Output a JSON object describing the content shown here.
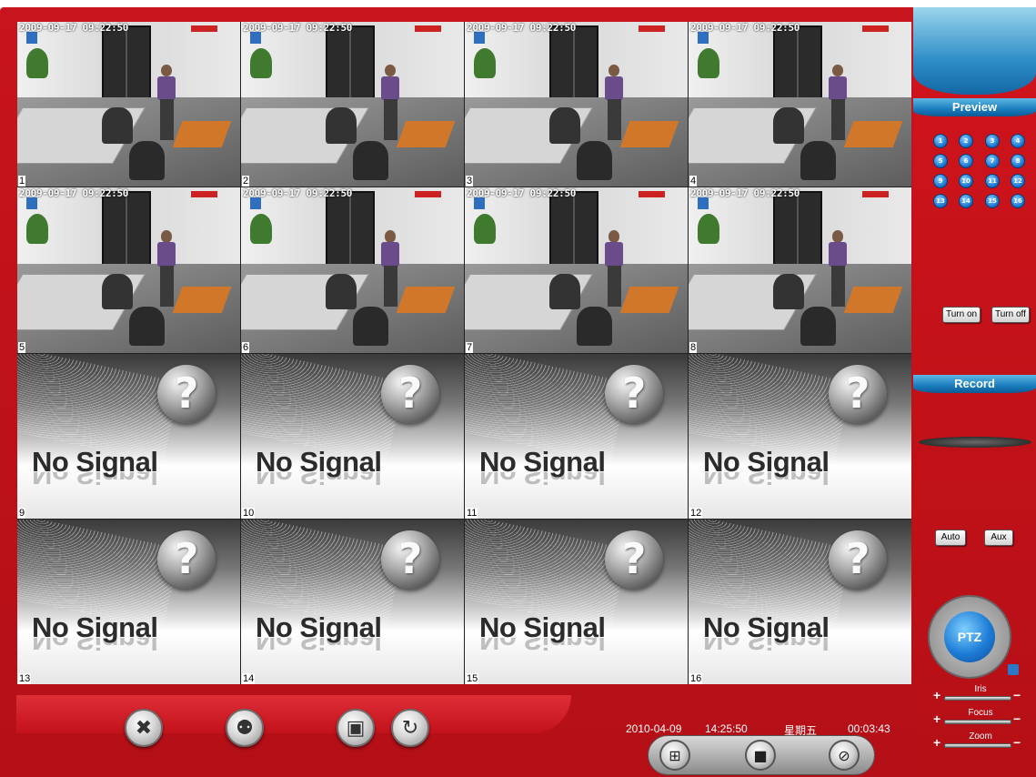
{
  "cameras": [
    {
      "num": "1",
      "timestamp": "2009-09-17 09:22:50"
    },
    {
      "num": "2",
      "timestamp": "2009-09-17 09:22:50"
    },
    {
      "num": "3",
      "timestamp": "2009-09-17 09:22:50"
    },
    {
      "num": "4",
      "timestamp": "2009-09-17 09:22:50"
    },
    {
      "num": "5",
      "timestamp": "2009-09-17 09:22:50"
    },
    {
      "num": "6",
      "timestamp": "2009-09-17 09:22:50"
    },
    {
      "num": "7",
      "timestamp": "2009-09-17 09:22:50"
    },
    {
      "num": "8",
      "timestamp": "2009-09-17 09:22:50"
    }
  ],
  "no_signal": {
    "text": "No Signal",
    "channels": [
      "9",
      "10",
      "11",
      "12",
      "13",
      "14",
      "15",
      "16"
    ]
  },
  "status": {
    "date": "2010-04-09",
    "time": "14:25:50",
    "weekday": "星期五",
    "elapsed": "00:03:43"
  },
  "right_panel": {
    "preview_title": "Preview",
    "record_title": "Record",
    "channel_buttons": [
      "1",
      "2",
      "3",
      "4",
      "5",
      "6",
      "7",
      "8",
      "9",
      "10",
      "11",
      "12",
      "13",
      "14",
      "15",
      "16"
    ],
    "turn_on": "Turn on",
    "turn_off": "Turn off",
    "auto": "Auto",
    "aux": "Aux",
    "ptz": "PTZ",
    "iris": "Iris",
    "focus": "Focus",
    "zoom": "Zoom",
    "plus": "+",
    "minus": "−"
  },
  "colors": {
    "frame_red": "#c8141c",
    "accent_blue": "#1a7cbd",
    "selected_outline": "#1a2bd0"
  },
  "icons": {
    "settings": "tools-icon",
    "playback": "film-reel-icon",
    "snapshot": "camera-icon",
    "refresh": "refresh-icon",
    "layout": "grid-layout-icon",
    "lock": "lock-icon",
    "exit": "exit-icon"
  }
}
